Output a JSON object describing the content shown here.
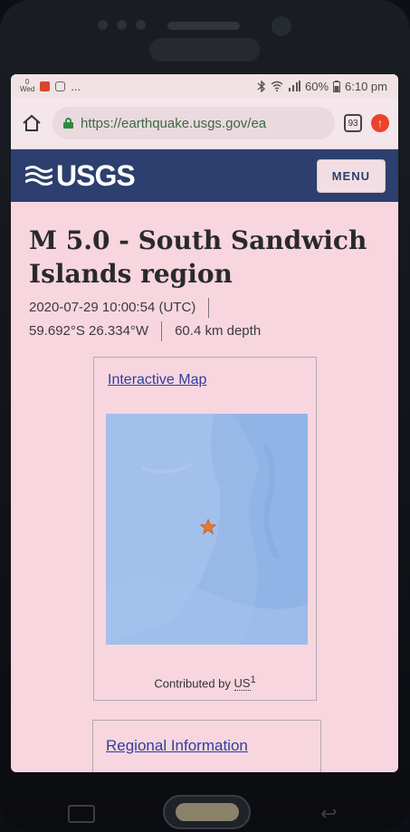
{
  "status_bar": {
    "date_top": "0",
    "date_bottom": "Wed",
    "battery": "60%",
    "time": "6:10 pm",
    "more": "..."
  },
  "browser": {
    "url": "https://earthquake.usgs.gov/ea",
    "tab_count": "93"
  },
  "header": {
    "logo_text": "USGS",
    "menu_label": "MENU"
  },
  "event": {
    "title": "M 5.0 - South Sandwich Islands region",
    "datetime": "2020-07-29 10:00:54 (UTC)",
    "location": "59.692°S 26.334°W",
    "depth": "60.4 km depth"
  },
  "map_card": {
    "link_label": "Interactive Map",
    "contributed_prefix": "Contributed by",
    "network": "US",
    "footnote": "1",
    "marker_icon": "star-icon",
    "marker_color": "#e8792c",
    "ocean_color": "#98b9e8"
  },
  "regional_card": {
    "link_label": "Regional Information"
  }
}
